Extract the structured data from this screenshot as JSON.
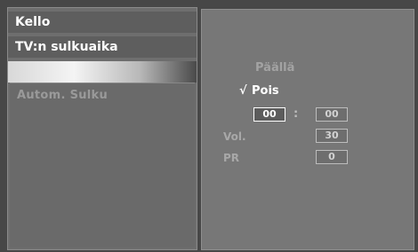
{
  "menu": {
    "items": [
      {
        "label": "Kello"
      },
      {
        "label": "TV:n sulkuaika"
      }
    ],
    "submenu_item": "Autom. Sulku"
  },
  "options": {
    "on_label": "Päällä",
    "off_label": "Pois",
    "selected_mark": "√"
  },
  "timer": {
    "hours": "00",
    "separator": ":",
    "minutes": "00"
  },
  "volume": {
    "label": "Vol.",
    "value": "30"
  },
  "program": {
    "label": "PR",
    "value": "0"
  }
}
